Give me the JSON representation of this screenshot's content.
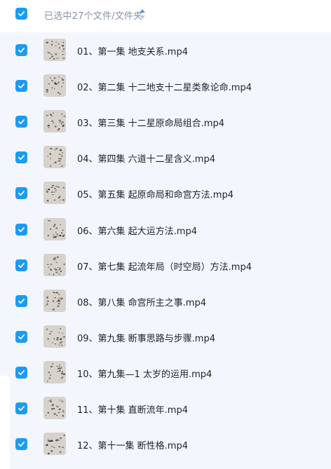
{
  "header": {
    "selection_text": "已选中27个文件/文件夹",
    "checked": true
  },
  "colors": {
    "accent": "#1e9bf0",
    "background": "#f3f7fd",
    "header_text": "#8a93a3"
  },
  "files": [
    {
      "name": "01、第一集 地支关系.mp4",
      "checked": true
    },
    {
      "name": "02、第二集 十二地支十二星类象论命.mp4",
      "checked": true
    },
    {
      "name": "03、第三集 十二星原命局组合.mp4",
      "checked": true
    },
    {
      "name": "04、第四集 六道十二星含义.mp4",
      "checked": true
    },
    {
      "name": "05、第五集 起原命局和命宫方法.mp4",
      "checked": true
    },
    {
      "name": "06、第六集 起大运方法.mp4",
      "checked": true
    },
    {
      "name": "07、第七集 起流年局（时空局）方法.mp4",
      "checked": true
    },
    {
      "name": "08、第八集 命宫所主之事.mp4",
      "checked": true
    },
    {
      "name": "09、第九集 断事思路与步骤.mp4",
      "checked": true
    },
    {
      "name": "10、第九集—1 太岁的运用.mp4",
      "checked": true
    },
    {
      "name": "11、第十集 直断流年.mp4",
      "checked": true
    },
    {
      "name": "12、第十一集 断性格.mp4",
      "checked": true
    }
  ]
}
